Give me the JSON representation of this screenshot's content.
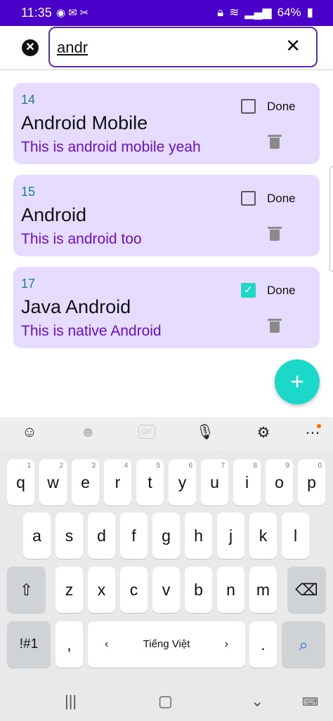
{
  "status_bar": {
    "time": "11:35",
    "battery": "64%"
  },
  "search": {
    "value": "andr",
    "clear_icon": "x-icon",
    "close_icon": "close-circle-icon"
  },
  "todos": [
    {
      "id": "14",
      "title": "Android Mobile",
      "description": "This is android mobile yeah",
      "done_label": "Done",
      "done": false
    },
    {
      "id": "15",
      "title": "Android",
      "description": "This is android too",
      "done_label": "Done",
      "done": false
    },
    {
      "id": "17",
      "title": "Java Android",
      "description": "This is native Android",
      "done_label": "Done",
      "done": true
    }
  ],
  "fab": {
    "label": "+"
  },
  "keyboard": {
    "row1": [
      {
        "k": "q",
        "hint": "1"
      },
      {
        "k": "w",
        "hint": "2"
      },
      {
        "k": "e",
        "hint": "3"
      },
      {
        "k": "r",
        "hint": "4"
      },
      {
        "k": "t",
        "hint": "5"
      },
      {
        "k": "y",
        "hint": "6"
      },
      {
        "k": "u",
        "hint": "7"
      },
      {
        "k": "i",
        "hint": "8"
      },
      {
        "k": "o",
        "hint": "9"
      },
      {
        "k": "p",
        "hint": "0"
      }
    ],
    "row2": [
      "a",
      "s",
      "d",
      "f",
      "g",
      "h",
      "j",
      "k",
      "l"
    ],
    "row3": [
      "z",
      "x",
      "c",
      "v",
      "b",
      "n",
      "m"
    ],
    "symbols_key": "!#1",
    "comma_key": ",",
    "space_label": "Tiếng Việt",
    "period_key": ".",
    "colors": {
      "fab": "#1cd8c8",
      "accent": "#6a10c4",
      "card_bg": "#e6dcff",
      "statusbar": "#4a00c8"
    }
  }
}
